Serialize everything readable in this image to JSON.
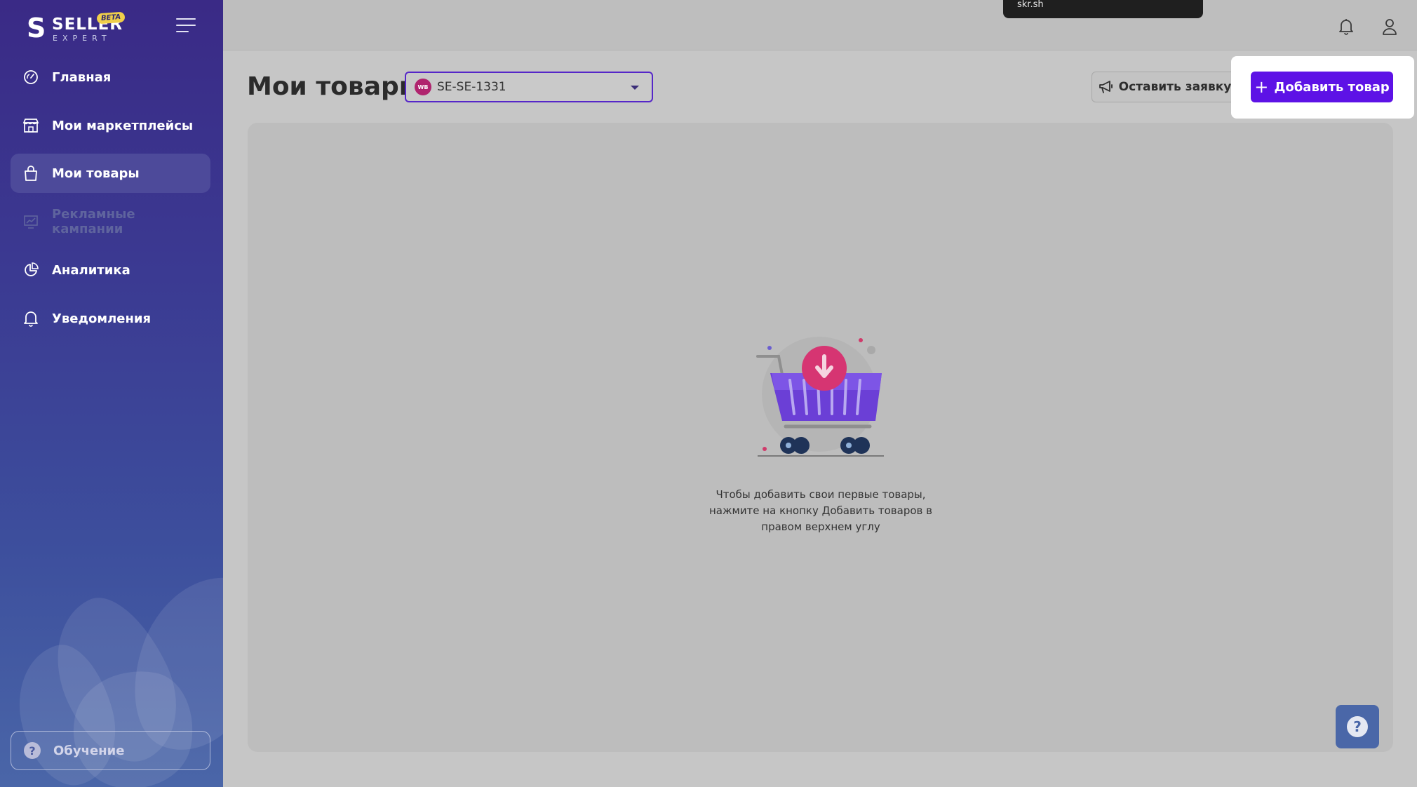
{
  "app": {
    "logo": {
      "letter": "S",
      "word": "SELLER",
      "subword": "EXPERT",
      "badge": "BETA"
    }
  },
  "sidebar": {
    "items": [
      {
        "label": "Главная",
        "icon": "speedometer-icon",
        "state": "normal"
      },
      {
        "label": "Мои маркетплейсы",
        "icon": "store-icon",
        "state": "normal"
      },
      {
        "label": "Мои товары",
        "icon": "shopping-bag-icon",
        "state": "active"
      },
      {
        "label": "Рекламные кампании",
        "icon": "chart-board-icon",
        "state": "disabled"
      },
      {
        "label": "Аналитика",
        "icon": "pie-chart-icon",
        "state": "normal"
      },
      {
        "label": "Уведомления",
        "icon": "bell-icon",
        "state": "normal"
      }
    ],
    "education_label": "Обучение"
  },
  "topbar": {
    "tooltip_text": "skr.sh",
    "icons": [
      "bell-icon",
      "user-icon"
    ]
  },
  "header": {
    "title": "Мои товары",
    "marketplace_select": {
      "badge": "WB",
      "value": "SE-SE-1331"
    },
    "request_button": "Оставить заявку",
    "add_button": "Добавить товар"
  },
  "content": {
    "empty_message_lines": [
      "Чтобы добавить свои первые товары,",
      "нажмите на кнопку Добавить товаров в",
      "правом верхнем углу"
    ]
  },
  "colors": {
    "accent": "#5d12e6",
    "sidebar_top": "#3a2a86",
    "sidebar_bottom": "#4a66a8",
    "overlay_bg": "#c6c6c6",
    "wb_brand": "#b0246e"
  }
}
